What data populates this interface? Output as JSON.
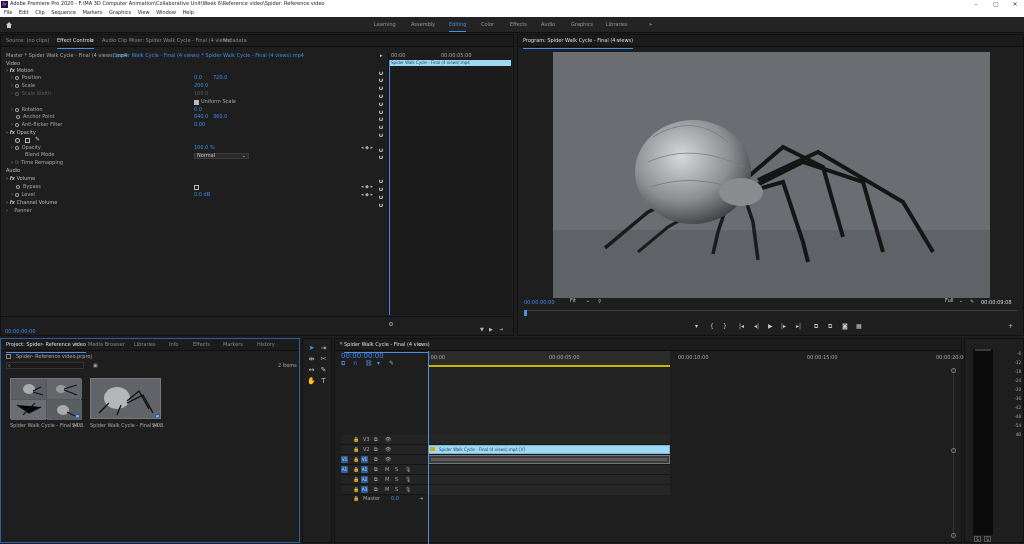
{
  "window": {
    "title": "Adobe Premiere Pro 2020 - F:\\MA 3D Computer Animation\\Collaborative Unit\\Week 6\\Reference video\\Spider: Reference video",
    "logo": "Pr"
  },
  "menu": [
    "File",
    "Edit",
    "Clip",
    "Sequence",
    "Markers",
    "Graphics",
    "View",
    "Window",
    "Help"
  ],
  "workspaces": [
    "Learning",
    "Assembly",
    "Editing",
    "Color",
    "Effects",
    "Audio",
    "Graphics",
    "Libraries"
  ],
  "workspace_more": "»",
  "source_panel": {
    "tabs": [
      "Source: (no clips)",
      "Effect Controls",
      "Audio Clip Mixer: Spider Walk Cycle - Final (4 views)",
      "Metadata"
    ],
    "master_line": "Master * Spider Walk Cycle - Final (4 views).mp4",
    "clip_line": "Spider Walk Cycle - Final (4 views) * Spider Walk Cycle - Final (4 views).mp4",
    "mini_time_start": "00:00",
    "mini_time_end": "00:00:05:00",
    "mini_clip": "Spider Walk Cycle - Final (4 views).mp4",
    "video_header": "Video",
    "motion": "Motion",
    "position_label": "Position",
    "position_x": "0.0",
    "position_y": "720.0",
    "scale_label": "Scale",
    "scale_val": "200.0",
    "scale_width_label": "Scale Width",
    "scale_width_val": "100.0",
    "uniform_label": "Uniform Scale",
    "rotation_label": "Rotation",
    "rotation_val": "0.0",
    "anchor_label": "Anchor Point",
    "anchor_x": "640.0",
    "anchor_y": "360.0",
    "flicker_label": "Anti-flicker Filter",
    "flicker_val": "0.00",
    "opacity_header": "Opacity",
    "opacity_label": "Opacity",
    "opacity_val": "100.0 %",
    "blend_label": "Blend Mode",
    "blend_val": "Normal",
    "time_remap": "Time Remapping",
    "audio_header": "Audio",
    "volume": "Volume",
    "bypass_label": "Bypass",
    "level_label": "Level",
    "level_val": "0.0 dB",
    "channel_volume": "Channel Volume",
    "panner": "Panner",
    "bottom_time": "00:00:00:00"
  },
  "program_monitor": {
    "tab": "Program: Spider Walk Cycle - Final (4 views)",
    "timecode": "00:00:00:00",
    "fit": "Fit",
    "quality": "Full",
    "duration": "00:00:09:08"
  },
  "project_panel": {
    "tabs": [
      "Project: Spider- Reference video",
      "Media Browser",
      "Libraries",
      "Info",
      "Effects",
      "Markers",
      "History"
    ],
    "project_file": "Spider- Reference video.prproj",
    "search_placeholder": "",
    "items_count": "2 Items",
    "items": [
      {
        "name": "Spider Walk Cycle - Final (4 ...",
        "dur": "9:08"
      },
      {
        "name": "Spider Walk Cycle - Final (4 ...",
        "dur": "9:08"
      }
    ]
  },
  "timeline": {
    "tab": "Spider Walk Cycle - Final (4 views)",
    "timecode": "00:00:00:00",
    "ruler": [
      ":00:00",
      "00:00:05:00",
      "00:00:10:00",
      "00:00:15:00",
      "00:00:20:00"
    ],
    "video_tracks": [
      "V3",
      "V2",
      "V1"
    ],
    "audio_tracks": [
      "A1",
      "A2",
      "A3"
    ],
    "master_label": "Master",
    "master_val": "0.0",
    "clip_label": "Spider Walk Cycle - Final (4 views).mp4 [V]",
    "mute": "M",
    "solo": "S"
  },
  "meters": {
    "scale": [
      "-6",
      "-12",
      "-18",
      "-24",
      "-30",
      "-36",
      "-42",
      "-48",
      "-54",
      "dB"
    ],
    "solo_buttons": [
      "S",
      "S"
    ]
  },
  "colors": {
    "accent": "#4a8fe7",
    "clip_video": "#9fd8f3",
    "bg": "#1e1e1e"
  }
}
